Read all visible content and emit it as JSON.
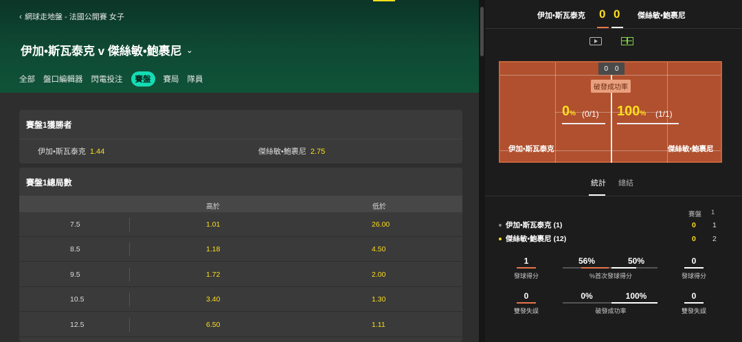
{
  "breadcrumb": {
    "back_icon": "chevron-left-icon",
    "text": "網球走地盤 - 法國公開賽 女子"
  },
  "match": {
    "title": "伊加•斯瓦泰克 v 傑絲敏•鮑裹尼",
    "dropdown_icon": "chevron-down-icon"
  },
  "tabs": [
    {
      "label": "全部"
    },
    {
      "label": "盤口編輯器"
    },
    {
      "label": "閃電投注"
    },
    {
      "label": "賽盤",
      "active": true
    },
    {
      "label": "賽局"
    },
    {
      "label": "隊員"
    }
  ],
  "set_winner": {
    "title": "賽盤1獲勝者",
    "p1": {
      "name": "伊加•斯瓦泰克",
      "odds": "1.44"
    },
    "p2": {
      "name": "傑絲敏•鮑裹尼",
      "odds": "2.75"
    }
  },
  "total_games": {
    "title": "賽盤1總局數",
    "headers": {
      "over": "高於",
      "under": "低於"
    },
    "rows": [
      {
        "line": "7.5",
        "over": "1.01",
        "under": "26.00"
      },
      {
        "line": "8.5",
        "over": "1.18",
        "under": "4.50"
      },
      {
        "line": "9.5",
        "over": "1.72",
        "under": "2.00"
      },
      {
        "line": "10.5",
        "over": "3.40",
        "under": "1.30"
      },
      {
        "line": "12.5",
        "over": "6.50",
        "under": "1.11"
      }
    ]
  },
  "scoreboard": {
    "p1": "伊加•斯瓦泰克",
    "p2": "傑絲敏•鮑裹尼",
    "s1": "0",
    "s2": "0",
    "icons": [
      "video-icon",
      "court-icon"
    ]
  },
  "court": {
    "box_s1": "0",
    "box_s2": "0",
    "label": "破發成功率",
    "p1_pct": "0",
    "p1_frac": "(0/1)",
    "p2_pct": "100",
    "p2_frac": "(1/1)",
    "pct_unit": "%",
    "p1_name": "伊加•斯瓦泰克",
    "p2_name": "傑絲敏•鮑裹尼"
  },
  "stats_tabs": [
    {
      "label": "統計"
    },
    {
      "label": "總結"
    }
  ],
  "sets_table": {
    "header_set": "賽盤",
    "header_1": "1",
    "players": [
      {
        "name": "伊加•斯瓦泰克 (1)",
        "sets": "0",
        "set1": "1",
        "dot": "#888888"
      },
      {
        "name": "傑絲敏•鮑裹尼 (12)",
        "sets": "0",
        "set1": "2",
        "dot": "#ffdf1b"
      }
    ]
  },
  "stats": {
    "aces": {
      "p1": "1",
      "p2": "0",
      "label": "發球得分"
    },
    "first_serve": {
      "p1": "56%",
      "p2": "50%",
      "label": "%首次發球得分"
    },
    "double_faults": {
      "p1": "0",
      "p2": "0",
      "label": "雙發失誤"
    },
    "break_points": {
      "p1": "0%",
      "p2": "100%",
      "label": "破發成功率"
    }
  },
  "colors": {
    "accent": "#14dcb4",
    "odds": "#ffdf1b",
    "p1": "#e8764a",
    "p2": "#ffffff",
    "court": "#b0502e"
  }
}
